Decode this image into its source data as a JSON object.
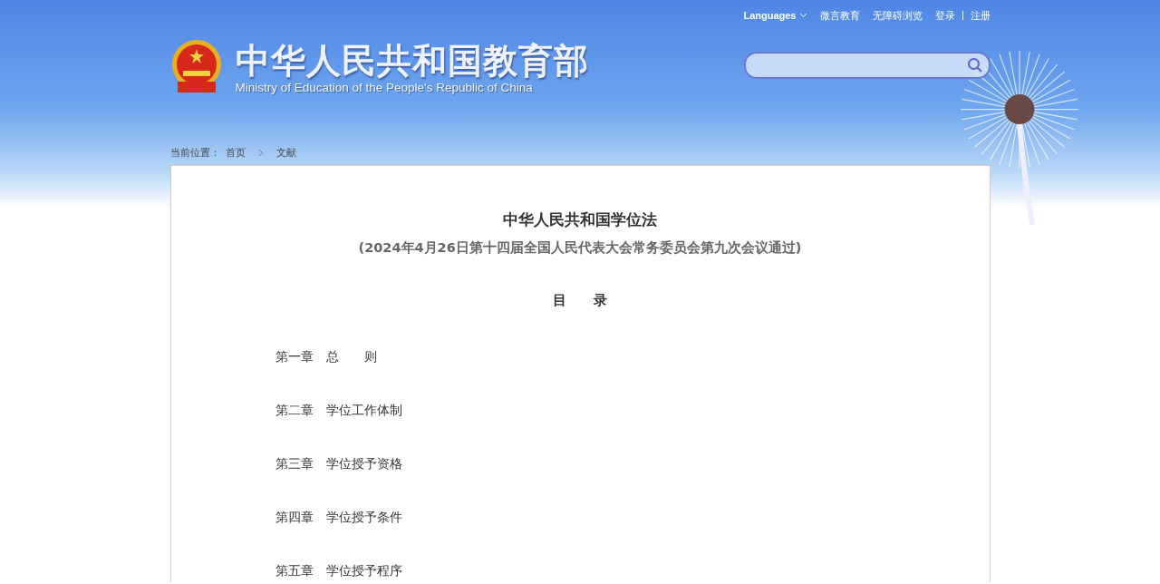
{
  "top_links": {
    "languages": "Languages",
    "links": [
      "微言教育",
      "无障碍浏览",
      "登录",
      "注册"
    ]
  },
  "logo": {
    "title": "中华人民共和国教育部",
    "subtitle": "Ministry of Education of the People's Republic of China"
  },
  "breadcrumb": {
    "label": "当前位置：",
    "items": [
      "首页",
      "文献"
    ]
  },
  "article": {
    "title": "中华人民共和国学位法",
    "subtitle": "(2024年4月26日第十四届全国人民代表大会常务委员会第九次会议通过)",
    "toc_heading": "目　　录",
    "chapters": [
      {
        "number": "第一章",
        "name": "总　　则"
      },
      {
        "number": "第二章",
        "name": "学位工作体制"
      },
      {
        "number": "第三章",
        "name": "学位授予资格"
      },
      {
        "number": "第四章",
        "name": "学位授予条件"
      },
      {
        "number": "第五章",
        "name": "学位授予程序"
      }
    ]
  }
}
